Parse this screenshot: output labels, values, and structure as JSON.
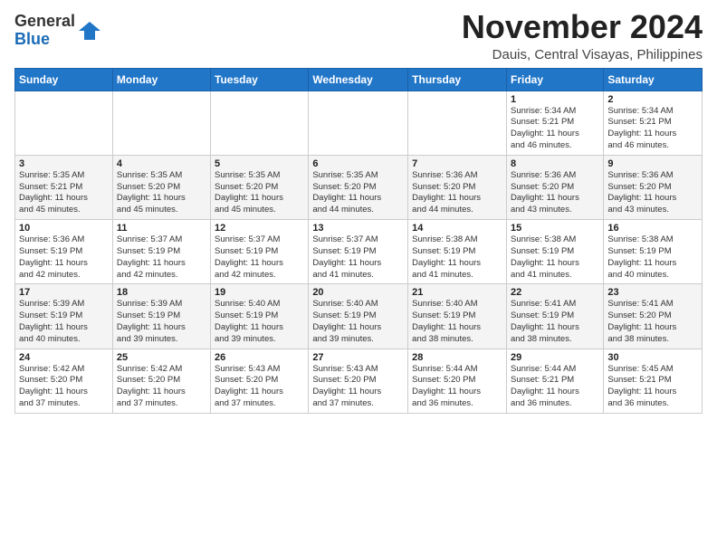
{
  "header": {
    "logo_general": "General",
    "logo_blue": "Blue",
    "month_title": "November 2024",
    "location": "Dauis, Central Visayas, Philippines"
  },
  "calendar": {
    "days_of_week": [
      "Sunday",
      "Monday",
      "Tuesday",
      "Wednesday",
      "Thursday",
      "Friday",
      "Saturday"
    ],
    "weeks": [
      [
        {
          "day": "",
          "info": ""
        },
        {
          "day": "",
          "info": ""
        },
        {
          "day": "",
          "info": ""
        },
        {
          "day": "",
          "info": ""
        },
        {
          "day": "",
          "info": ""
        },
        {
          "day": "1",
          "info": "Sunrise: 5:34 AM\nSunset: 5:21 PM\nDaylight: 11 hours\nand 46 minutes."
        },
        {
          "day": "2",
          "info": "Sunrise: 5:34 AM\nSunset: 5:21 PM\nDaylight: 11 hours\nand 46 minutes."
        }
      ],
      [
        {
          "day": "3",
          "info": "Sunrise: 5:35 AM\nSunset: 5:21 PM\nDaylight: 11 hours\nand 45 minutes."
        },
        {
          "day": "4",
          "info": "Sunrise: 5:35 AM\nSunset: 5:20 PM\nDaylight: 11 hours\nand 45 minutes."
        },
        {
          "day": "5",
          "info": "Sunrise: 5:35 AM\nSunset: 5:20 PM\nDaylight: 11 hours\nand 45 minutes."
        },
        {
          "day": "6",
          "info": "Sunrise: 5:35 AM\nSunset: 5:20 PM\nDaylight: 11 hours\nand 44 minutes."
        },
        {
          "day": "7",
          "info": "Sunrise: 5:36 AM\nSunset: 5:20 PM\nDaylight: 11 hours\nand 44 minutes."
        },
        {
          "day": "8",
          "info": "Sunrise: 5:36 AM\nSunset: 5:20 PM\nDaylight: 11 hours\nand 43 minutes."
        },
        {
          "day": "9",
          "info": "Sunrise: 5:36 AM\nSunset: 5:20 PM\nDaylight: 11 hours\nand 43 minutes."
        }
      ],
      [
        {
          "day": "10",
          "info": "Sunrise: 5:36 AM\nSunset: 5:19 PM\nDaylight: 11 hours\nand 42 minutes."
        },
        {
          "day": "11",
          "info": "Sunrise: 5:37 AM\nSunset: 5:19 PM\nDaylight: 11 hours\nand 42 minutes."
        },
        {
          "day": "12",
          "info": "Sunrise: 5:37 AM\nSunset: 5:19 PM\nDaylight: 11 hours\nand 42 minutes."
        },
        {
          "day": "13",
          "info": "Sunrise: 5:37 AM\nSunset: 5:19 PM\nDaylight: 11 hours\nand 41 minutes."
        },
        {
          "day": "14",
          "info": "Sunrise: 5:38 AM\nSunset: 5:19 PM\nDaylight: 11 hours\nand 41 minutes."
        },
        {
          "day": "15",
          "info": "Sunrise: 5:38 AM\nSunset: 5:19 PM\nDaylight: 11 hours\nand 41 minutes."
        },
        {
          "day": "16",
          "info": "Sunrise: 5:38 AM\nSunset: 5:19 PM\nDaylight: 11 hours\nand 40 minutes."
        }
      ],
      [
        {
          "day": "17",
          "info": "Sunrise: 5:39 AM\nSunset: 5:19 PM\nDaylight: 11 hours\nand 40 minutes."
        },
        {
          "day": "18",
          "info": "Sunrise: 5:39 AM\nSunset: 5:19 PM\nDaylight: 11 hours\nand 39 minutes."
        },
        {
          "day": "19",
          "info": "Sunrise: 5:40 AM\nSunset: 5:19 PM\nDaylight: 11 hours\nand 39 minutes."
        },
        {
          "day": "20",
          "info": "Sunrise: 5:40 AM\nSunset: 5:19 PM\nDaylight: 11 hours\nand 39 minutes."
        },
        {
          "day": "21",
          "info": "Sunrise: 5:40 AM\nSunset: 5:19 PM\nDaylight: 11 hours\nand 38 minutes."
        },
        {
          "day": "22",
          "info": "Sunrise: 5:41 AM\nSunset: 5:19 PM\nDaylight: 11 hours\nand 38 minutes."
        },
        {
          "day": "23",
          "info": "Sunrise: 5:41 AM\nSunset: 5:20 PM\nDaylight: 11 hours\nand 38 minutes."
        }
      ],
      [
        {
          "day": "24",
          "info": "Sunrise: 5:42 AM\nSunset: 5:20 PM\nDaylight: 11 hours\nand 37 minutes."
        },
        {
          "day": "25",
          "info": "Sunrise: 5:42 AM\nSunset: 5:20 PM\nDaylight: 11 hours\nand 37 minutes."
        },
        {
          "day": "26",
          "info": "Sunrise: 5:43 AM\nSunset: 5:20 PM\nDaylight: 11 hours\nand 37 minutes."
        },
        {
          "day": "27",
          "info": "Sunrise: 5:43 AM\nSunset: 5:20 PM\nDaylight: 11 hours\nand 37 minutes."
        },
        {
          "day": "28",
          "info": "Sunrise: 5:44 AM\nSunset: 5:20 PM\nDaylight: 11 hours\nand 36 minutes."
        },
        {
          "day": "29",
          "info": "Sunrise: 5:44 AM\nSunset: 5:21 PM\nDaylight: 11 hours\nand 36 minutes."
        },
        {
          "day": "30",
          "info": "Sunrise: 5:45 AM\nSunset: 5:21 PM\nDaylight: 11 hours\nand 36 minutes."
        }
      ]
    ]
  }
}
